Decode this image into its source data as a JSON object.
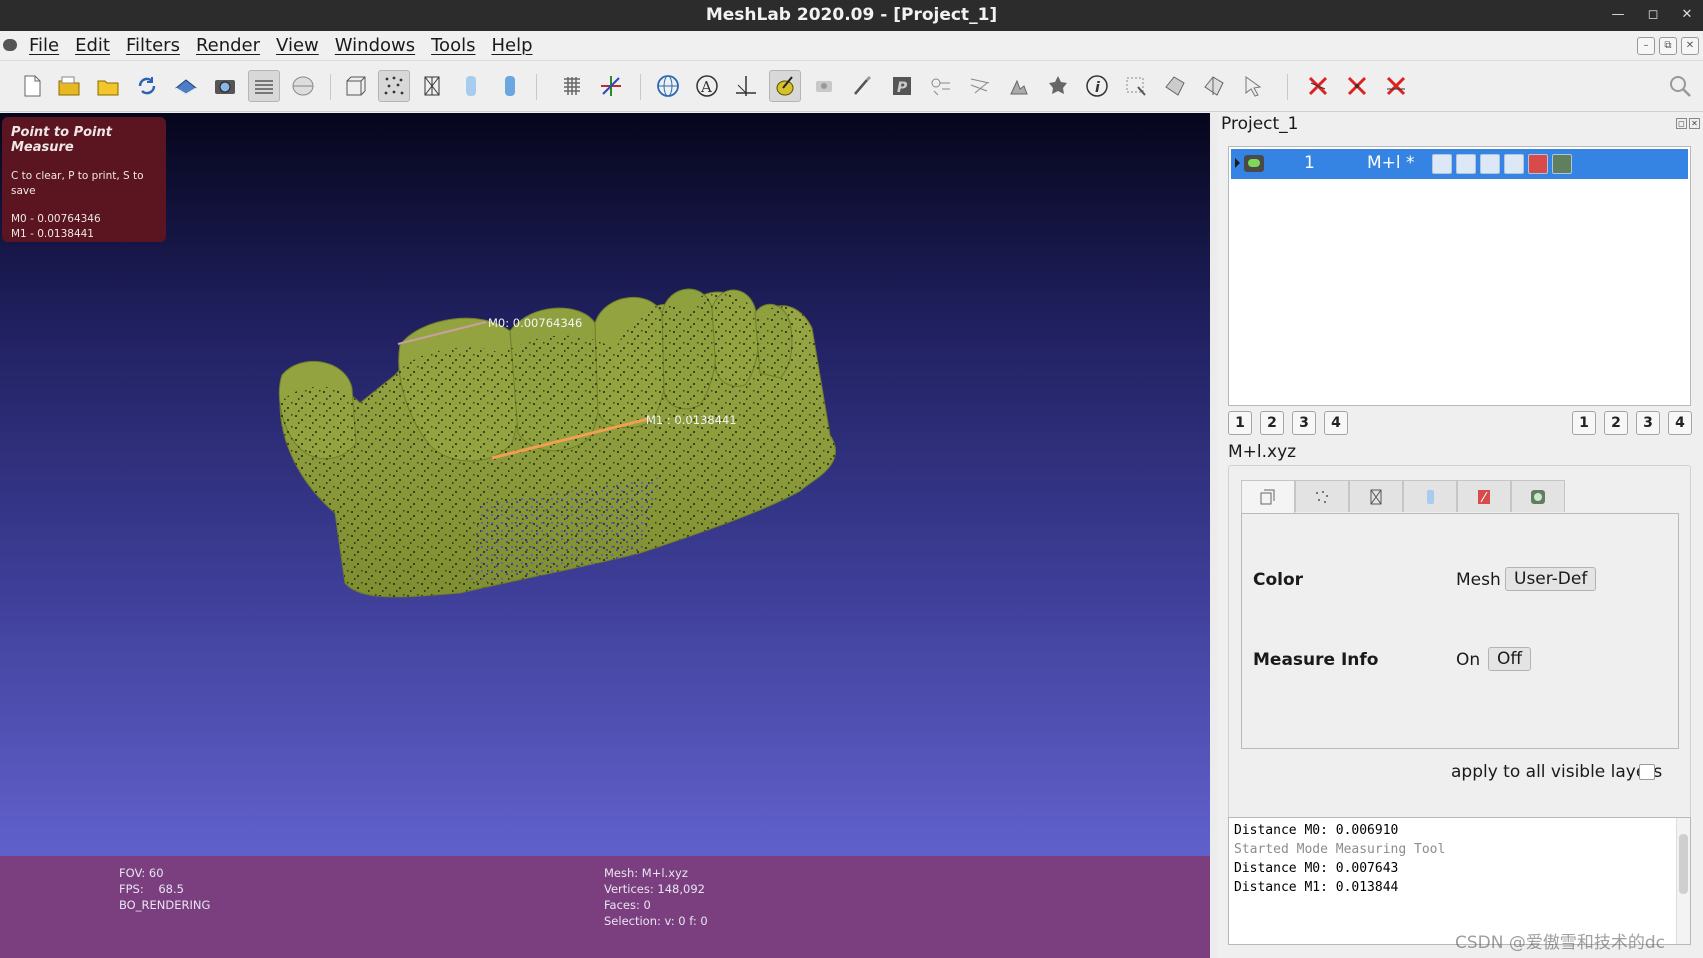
{
  "window": {
    "title": "MeshLab 2020.09 - [Project_1]"
  },
  "menu": [
    "File",
    "Edit",
    "Filters",
    "Render",
    "View",
    "Windows",
    "Tools",
    "Help"
  ],
  "toolbar": {
    "icons": [
      "new-project-icon",
      "open-project-icon",
      "import-mesh-icon",
      "reload-icon",
      "export-icon",
      "snapshot-icon",
      "layers-icon",
      "show-raster-icon",
      "bounding-box-icon",
      "points-icon",
      "wireframe-icon",
      "flat-icon",
      "smooth-icon",
      "texture-icon",
      "axis-icon",
      "trackball-icon",
      "annotation-icon",
      "fit-icon",
      "measure-tool-icon",
      "camera-icon",
      "paint-icon",
      "pickpoints-icon",
      "align-icon",
      "select-icon",
      "manipulator-icon",
      "georef-icon",
      "info-icon",
      "select-faces-icon",
      "select-vertices-icon",
      "select-connected-icon",
      "select-cursor-icon",
      "delete-faces-icon",
      "delete-vertices-icon",
      "delete-all-icon",
      "search-icon"
    ]
  },
  "viewport": {
    "info": {
      "title": "Point to Point Measure",
      "hint": "C to clear, P to print, S to save",
      "m0": "M0 - 0.00764346",
      "m1": "M1 - 0.0138441"
    },
    "labels": {
      "m0": "M0: 0.00764346",
      "m1": "M1 : 0.0138441"
    },
    "status": {
      "fov": "FOV: 60",
      "fps": "FPS:    68.5",
      "mode": "BO_RENDERING",
      "mesh": "Mesh: M+l.xyz",
      "vertices": "Vertices: 148,092",
      "faces": "Faces: 0",
      "selection": "Selection: v: 0 f: 0"
    },
    "colors": {
      "mesh": "#8a9a3a",
      "measure": "#f0a050",
      "status_bg": "#7b3f7f",
      "info_bg": "#5a1521"
    }
  },
  "project": {
    "title": "Project_1",
    "layer": {
      "index": "1",
      "name": "M+l *"
    },
    "left_views": [
      "1",
      "2",
      "3",
      "4"
    ],
    "right_views": [
      "1",
      "2",
      "3",
      "4"
    ],
    "file": "M+l.xyz",
    "props": {
      "color_label": "Color",
      "color_target": "Mesh",
      "color_value": "User-Def",
      "measure_label": "Measure Info",
      "measure_on": "On",
      "measure_off": "Off",
      "apply_all": "apply to all visible layers"
    }
  },
  "log": [
    {
      "text": "Distance M0: 0.006910",
      "dim": false
    },
    {
      "text": "Started Mode Measuring Tool",
      "dim": true
    },
    {
      "text": "Distance M0: 0.007643",
      "dim": false
    },
    {
      "text": "Distance M1: 0.013844",
      "dim": false
    }
  ],
  "watermark": "CSDN @爱傲雪和技术的dc"
}
